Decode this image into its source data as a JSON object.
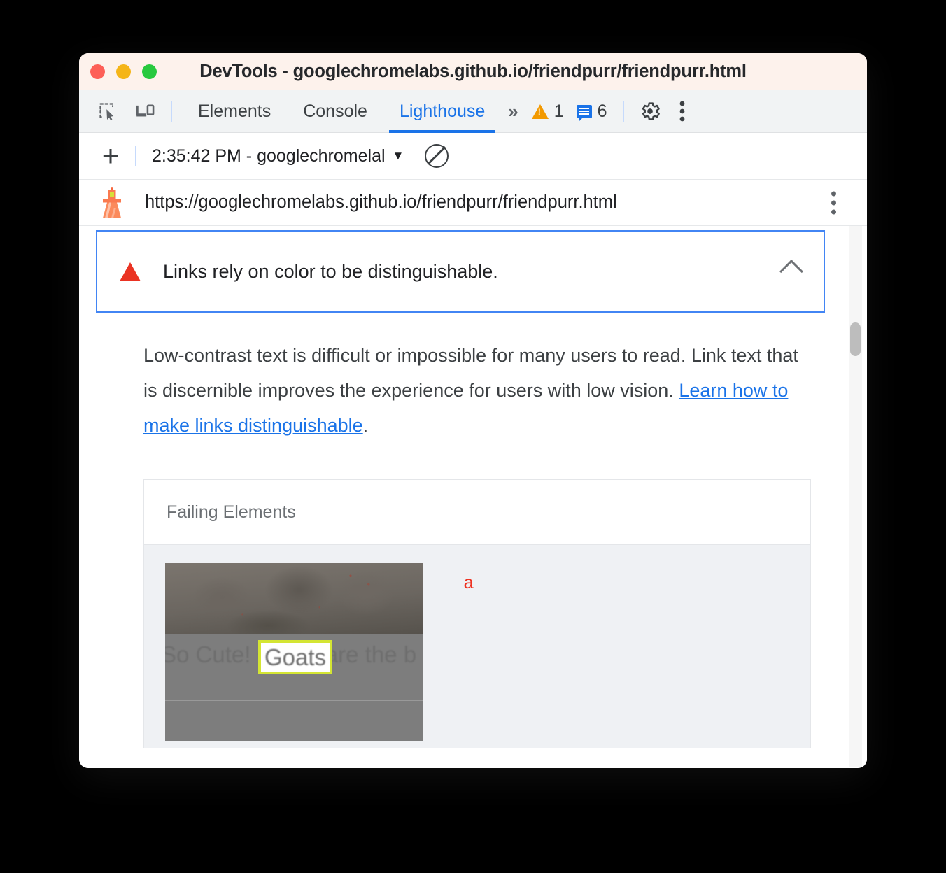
{
  "window": {
    "title": "DevTools - googlechromelabs.github.io/friendpurr/friendpurr.html",
    "traffic_lights": [
      "close",
      "minimize",
      "maximize"
    ]
  },
  "devtools_toolbar": {
    "inspect_icon": "inspect-element-icon",
    "device_icon": "device-toolbar-icon",
    "tabs": [
      {
        "label": "Elements",
        "active": false
      },
      {
        "label": "Console",
        "active": false
      },
      {
        "label": "Lighthouse",
        "active": true
      }
    ],
    "more_tabs_icon": "chevron-double-right-icon",
    "warning_icon": "warning-triangle-icon",
    "warning_count": "1",
    "message_icon": "message-bubble-icon",
    "message_count": "6",
    "settings_icon": "gear-icon",
    "menu_icon": "kebab-menu-icon"
  },
  "lighthouse_bar": {
    "new_report_icon": "plus-icon",
    "run_selected": "2:35:42 PM - googlechromelal",
    "dropdown_icon": "caret-down-icon",
    "clear_icon": "no-entry-icon"
  },
  "url_bar": {
    "icon": "lighthouse-icon",
    "url": "https://googlechromelabs.github.io/friendpurr/friendpurr.html",
    "menu_icon": "kebab-menu-icon"
  },
  "report": {
    "audit": {
      "severity_icon": "red-triangle-icon",
      "title": "Links rely on color to be distinguishable.",
      "collapse_icon": "chevron-up-icon",
      "expanded": true
    },
    "description": {
      "text_before_link": "Low-contrast text is difficult or impossible for many users to read. Link text that is discernible improves the experience for users with low vision. ",
      "link_text": "Learn how to make links distinguishable",
      "text_after_link": "."
    },
    "failing_elements_table": {
      "header": "Failing Elements",
      "rows": [
        {
          "thumbnail_text": "So Cute! Goats are the b",
          "highlighted_text": "Goats",
          "element_tag": "a"
        }
      ]
    },
    "scrollbar": {
      "track": "report-scrollbar-track",
      "thumb": "report-scrollbar-thumb"
    }
  },
  "colors": {
    "accent_blue": "#1a73e8",
    "audit_border": "#4285f4",
    "severity_red": "#ea3323",
    "warning_orange": "#f29900",
    "highlight_yellow": "#d4e533",
    "element_tag_red": "#ee3322",
    "titlebar_bg": "#fdf2ec",
    "toolbar_bg": "#f1f3f4",
    "row_bg": "#eff1f4"
  }
}
